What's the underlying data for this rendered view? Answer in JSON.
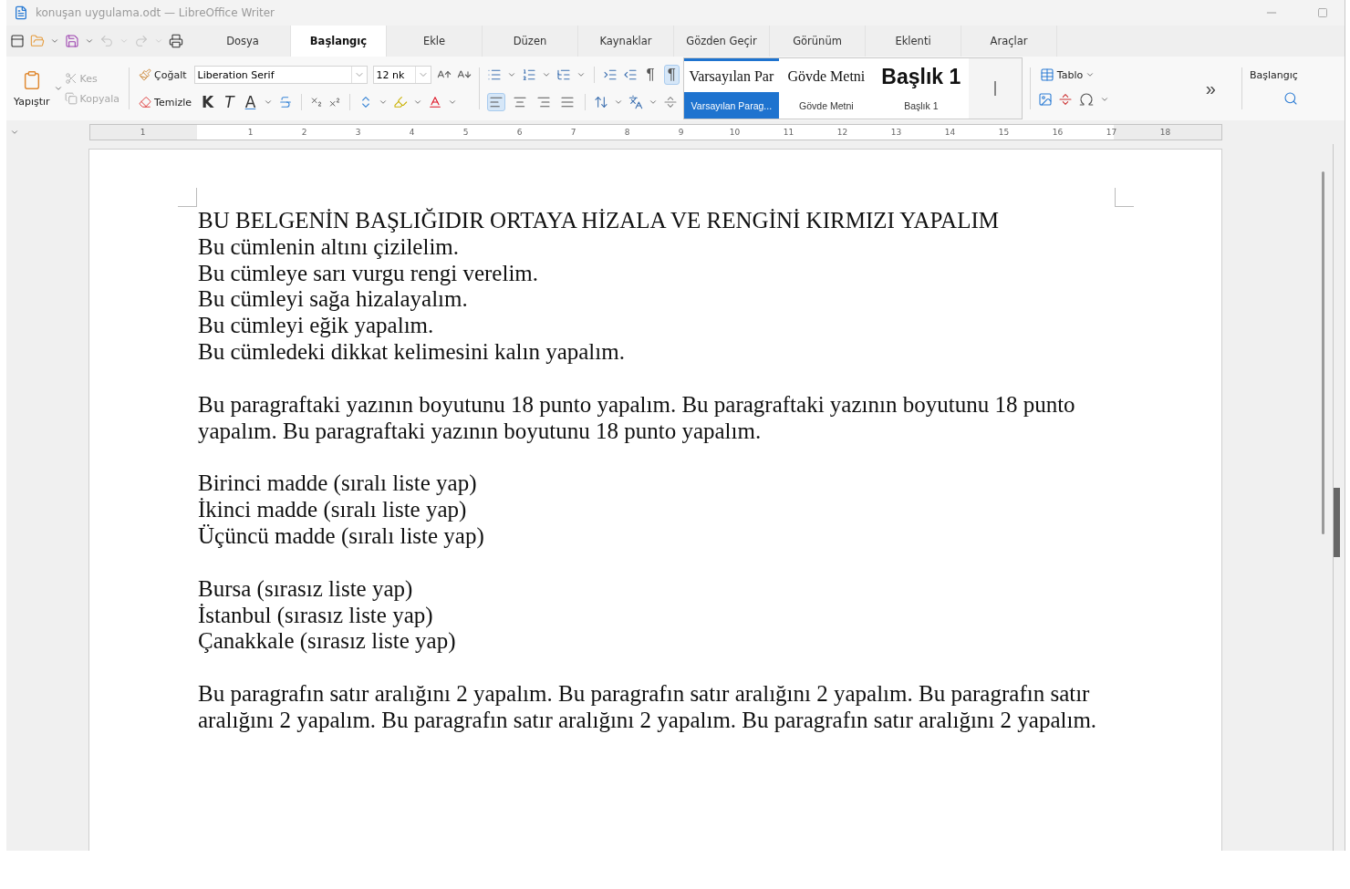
{
  "window": {
    "title": "konuşan uygulama.odt — LibreOffice Writer"
  },
  "tabs": [
    {
      "label": "Dosya",
      "selected": false
    },
    {
      "label": "Başlangıç",
      "selected": true
    },
    {
      "label": "Ekle",
      "selected": false
    },
    {
      "label": "Düzen",
      "selected": false
    },
    {
      "label": "Kaynaklar",
      "selected": false
    },
    {
      "label": "Gözden Geçir",
      "selected": false
    },
    {
      "label": "Görünüm",
      "selected": false
    },
    {
      "label": "Eklenti",
      "selected": false
    },
    {
      "label": "Araçlar",
      "selected": false
    }
  ],
  "clipboard": {
    "paste": "Yapıştır",
    "cut": {
      "label": "Kes",
      "disabled": true
    },
    "copy": {
      "label": "Kopyala",
      "disabled": true
    },
    "clone": "Çoğalt",
    "clear": "Temizle"
  },
  "font": {
    "name": "Liberation Serif",
    "size": "12 nk"
  },
  "format_buttons": [
    {
      "kind": "bold",
      "label": "K"
    },
    {
      "kind": "italic",
      "label": "T"
    },
    {
      "kind": "underline",
      "label": "A"
    }
  ],
  "marks_toggles": [
    {
      "label": "¶",
      "selected": false
    },
    {
      "label": "¶",
      "selected": true
    }
  ],
  "alignment": [
    {
      "kind": "left",
      "selected": true
    },
    {
      "kind": "center",
      "selected": false
    },
    {
      "kind": "right",
      "selected": false
    },
    {
      "kind": "justify",
      "selected": false
    }
  ],
  "styles": [
    {
      "kind": "default",
      "preview": "Varsayılan Par",
      "label": "Varsayılan Parag...",
      "selected": true
    },
    {
      "kind": "body",
      "preview": "Gövde Metni",
      "label": "Gövde Metni",
      "selected": false
    },
    {
      "kind": "heading",
      "preview": "Başlık 1",
      "label": "Başlık 1",
      "selected": false
    }
  ],
  "insert": {
    "table": "Tablo",
    "more": "»"
  },
  "sidebar": {
    "title": "Başlangıç"
  },
  "ruler": {
    "left_labels": [
      "1"
    ],
    "labels": [
      "1",
      "2",
      "3",
      "4",
      "5",
      "6",
      "7",
      "8",
      "9",
      "10",
      "11",
      "12",
      "13",
      "14",
      "15",
      "16",
      "17",
      "18"
    ]
  },
  "document": {
    "groups": [
      [
        "BU BELGENİN BAŞLIĞIDIR ORTAYA HİZALA VE RENGİNİ KIRMIZI YAPALIM",
        "Bu cümlenin altını çizilelim.",
        "Bu cümleye sarı vurgu rengi verelim.",
        "Bu cümleyi sağa hizalayalım.",
        "Bu cümleyi eğik yapalım.",
        "Bu cümledeki dikkat kelimesini kalın yapalım."
      ],
      [
        "Bu paragraftaki yazının boyutunu 18 punto yapalım. Bu paragraftaki yazının boyutunu 18 punto yapalım. Bu paragraftaki yazının boyutunu 18 punto yapalım."
      ],
      [
        "Birinci madde (sıralı liste yap)",
        "İkinci madde (sıralı liste yap)",
        "Üçüncü madde (sıralı liste yap)"
      ],
      [
        "Bursa (sırasız liste yap)",
        "İstanbul (sırasız liste yap)",
        "Çanakkale (sırasız liste yap)"
      ],
      [
        "Bu paragrafın satır aralığını 2 yapalım. Bu paragrafın satır aralığını 2 yapalım. Bu paragrafın satır aralığını 2 yapalım. Bu paragrafın satır aralığını 2 yapalım. Bu paragrafın satır aralığını 2 yapalım."
      ]
    ]
  }
}
